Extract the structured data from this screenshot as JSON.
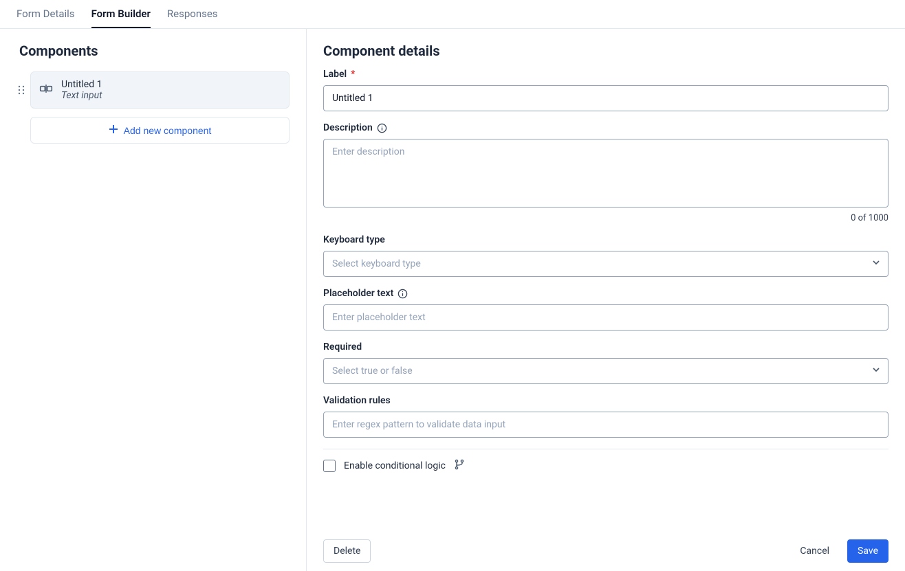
{
  "tabs": [
    {
      "label": "Form Details",
      "active": false
    },
    {
      "label": "Form Builder",
      "active": true
    },
    {
      "label": "Responses",
      "active": false
    }
  ],
  "sidebar": {
    "heading": "Components",
    "component": {
      "title": "Untitled 1",
      "type": "Text input"
    },
    "add_label": "Add new component"
  },
  "details": {
    "heading": "Component details",
    "label_field": {
      "label": "Label",
      "required_mark": "*",
      "value": "Untitled 1"
    },
    "description_field": {
      "label": "Description",
      "placeholder": "Enter description",
      "char_count": "0 of 1000"
    },
    "keyboard_field": {
      "label": "Keyboard type",
      "placeholder": "Select keyboard type"
    },
    "placeholder_field": {
      "label": "Placeholder text",
      "placeholder": "Enter placeholder text"
    },
    "required_field": {
      "label": "Required",
      "placeholder": "Select true or false"
    },
    "validation_field": {
      "label": "Validation rules",
      "placeholder": "Enter regex pattern to validate data input"
    },
    "conditional": {
      "label": "Enable conditional logic"
    },
    "buttons": {
      "delete": "Delete",
      "cancel": "Cancel",
      "save": "Save"
    }
  }
}
